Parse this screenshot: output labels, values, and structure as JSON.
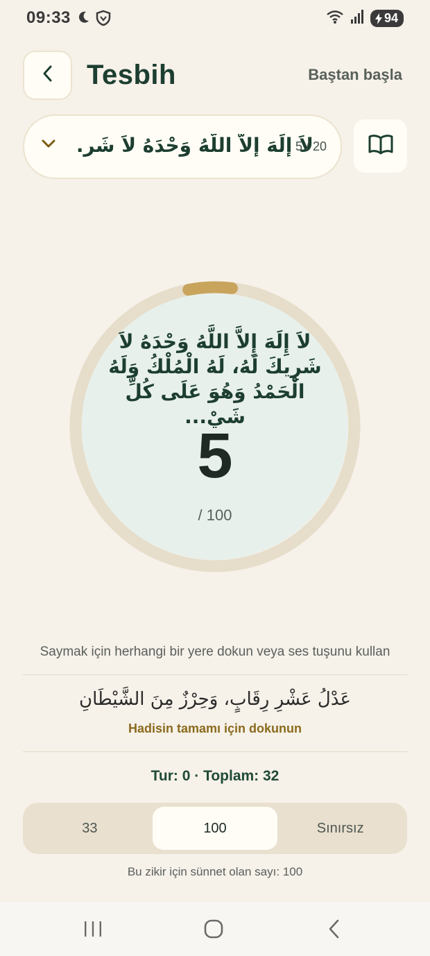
{
  "status": {
    "time": "09:33",
    "battery": "94",
    "icons_left": [
      "moon-icon",
      "shield-icon"
    ],
    "icons_right": [
      "wifi-icon",
      "signal-icon",
      "battery-icon"
    ]
  },
  "header": {
    "title": "Tesbih",
    "restart_label": "Baştan başla"
  },
  "selector": {
    "arabic": "لاَ إِلَهَ إِلاَّ اللَّهُ وَحْدَهُ لاَ شَرِ...",
    "counter": "5 / 20"
  },
  "counter": {
    "arabic": "لاَ إِلَهَ إِلاَّ اللَّهُ وَحْدَهُ لاَ شَرِيكَ لَهُ، لَهُ الْمُلْكُ وَلَهُ الْحَمْدُ وَهُوَ عَلَى كُلِّ شَيْ...",
    "count": "5",
    "target": "/ 100",
    "progress": 0.05
  },
  "hint": "Saymak için herhangi bir yere dokun veya ses tuşunu kullan",
  "hadith": {
    "arabic": "عَدْلُ عَشْرِ رِقَابٍ، وَحِرْزٌ مِنَ الشَّيْطَانِ",
    "link": "Hadisin tamamı için dokunun"
  },
  "stats": "Tur: 0 · Toplam: 32",
  "segments": [
    {
      "label": "33",
      "active": false
    },
    {
      "label": "100",
      "active": true
    },
    {
      "label": "Sınırsız",
      "active": false
    }
  ],
  "sunnah_note": "Bu zikir için sünnet olan sayı: 100",
  "colors": {
    "background": "#f6f1e9",
    "ring_track": "#e6ddca",
    "ring_progress": "#c9a45c",
    "accent_text": "#1c3e30",
    "link_gold": "#8a6a1c"
  },
  "navbar": [
    "recents-icon",
    "home-icon",
    "back-icon"
  ]
}
